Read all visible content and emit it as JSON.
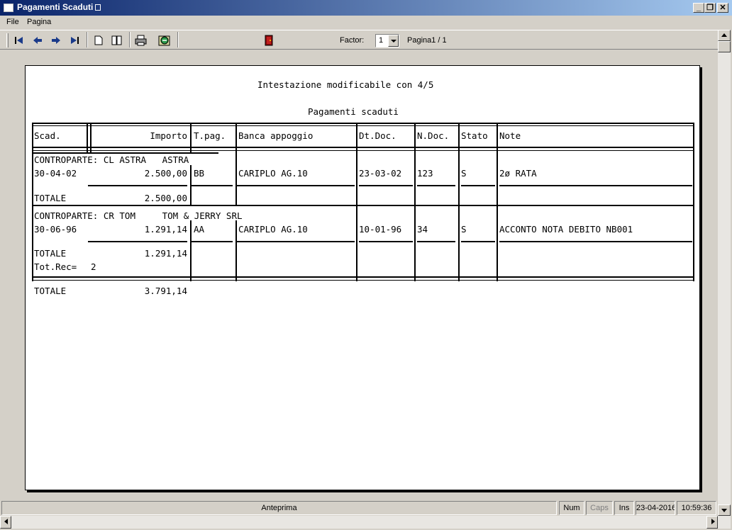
{
  "window": {
    "title": "Pagamenti Scaduti"
  },
  "menu": {
    "items": [
      "File",
      "Pagina"
    ]
  },
  "toolbar": {
    "factor_label": "Factor:",
    "factor_value": "1",
    "page_label": "Pagina1 / 1",
    "icons": [
      "first-page-icon",
      "prev-page-icon",
      "next-page-icon",
      "last-page-icon",
      "single-page-icon",
      "two-pages-icon",
      "print-icon",
      "export-icon",
      "exit-door-icon"
    ]
  },
  "report": {
    "header": "Intestazione modificabile con 4/5",
    "title": "Pagamenti scaduti",
    "columns": [
      "Scad.",
      "Importo",
      "T.pag.",
      "Banca appoggio",
      "Dt.Doc.",
      "N.Doc.",
      "Stato",
      "Note"
    ],
    "groups": [
      {
        "controparte": "CONTROPARTE: CL ASTRA   ASTRA",
        "rows": [
          {
            "scad": "30-04-02",
            "importo": "2.500,00",
            "tpag": "BB",
            "banca": "CARIPLO AG.10",
            "dtdoc": "23-03-02",
            "ndoc": "123",
            "stato": "S",
            "note": "2ø RATA"
          }
        ],
        "totale_label": "TOTALE",
        "totale": "2.500,00"
      },
      {
        "controparte": "CONTROPARTE: CR TOM     TOM & JERRY SRL",
        "rows": [
          {
            "scad": "30-06-96",
            "importo": "1.291,14",
            "tpag": "AA",
            "banca": "CARIPLO AG.10",
            "dtdoc": "10-01-96",
            "ndoc": "34",
            "stato": "S",
            "note": "ACCONTO NOTA DEBITO NB001"
          }
        ],
        "totale_label": "TOTALE",
        "totale": "1.291,14"
      }
    ],
    "totrec_label": "Tot.Rec=",
    "totrec_value": "2",
    "grand_total_label": "TOTALE",
    "grand_total": "3.791,14"
  },
  "status": {
    "mode": "Anteprima",
    "num": "Num",
    "caps": "Caps",
    "ins": "Ins",
    "date": "23-04-2016",
    "time": "10:59:36"
  },
  "colors": {
    "titlebar_start": "#0a246a",
    "titlebar_end": "#a6caf0",
    "chrome": "#d4d0c8"
  }
}
